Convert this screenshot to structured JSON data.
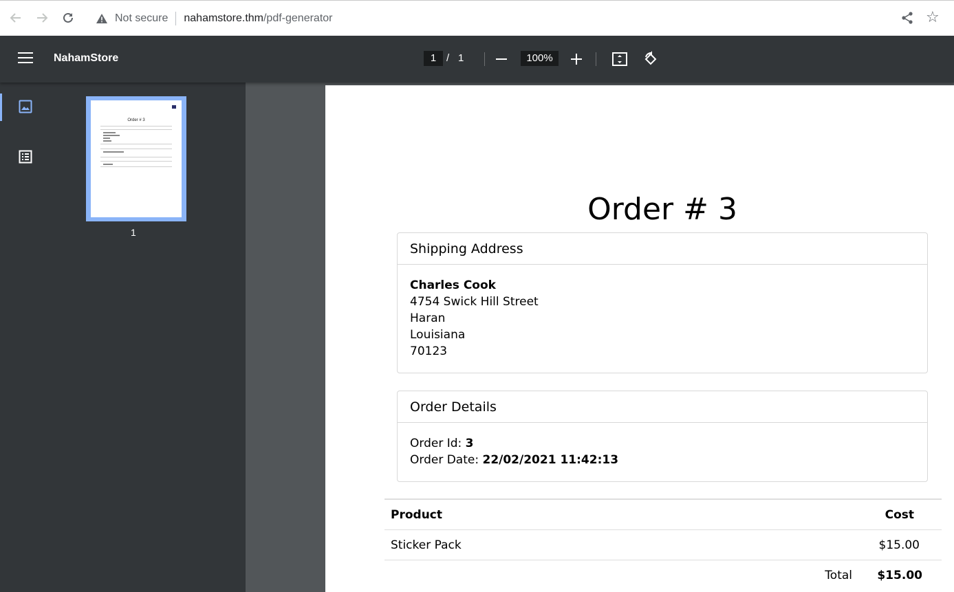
{
  "browser": {
    "security_label": "Not secure",
    "url_host": "nahamstore.thm",
    "url_path": "/pdf-generator"
  },
  "toolbar": {
    "title": "NahamStore",
    "page_current": "1",
    "page_separator": "/",
    "page_total": "1",
    "zoom": "100%"
  },
  "sidebar": {
    "thumbnail_page_number": "1",
    "thumbnail_title": "Order # 3"
  },
  "document": {
    "title": "Order # 3",
    "shipping": {
      "header": "Shipping Address",
      "name": "Charles Cook",
      "street": "4754 Swick Hill Street",
      "city": "Haran",
      "state": "Louisiana",
      "zip": "70123"
    },
    "details": {
      "header": "Order Details",
      "id_label": "Order Id:",
      "id_value": "3",
      "date_label": "Order Date:",
      "date_value": "22/02/2021 11:42:13"
    },
    "table": {
      "headers": [
        "Product",
        "Cost"
      ],
      "rows": [
        {
          "product": "Sticker Pack",
          "cost": "$15.00"
        }
      ],
      "total_label": "Total",
      "total_value": "$15.00"
    }
  },
  "colors": {
    "toolbar_bg": "#323639",
    "viewer_bg": "#525659",
    "accent": "#8ab4f8"
  }
}
